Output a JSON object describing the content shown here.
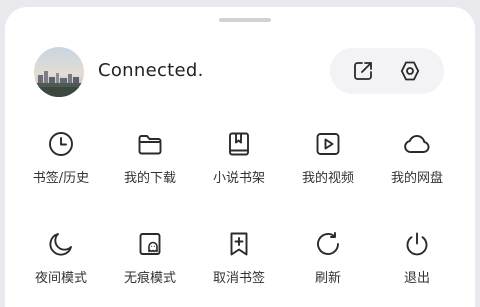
{
  "profile": {
    "status_text": "Connected."
  },
  "header_actions": {
    "share_icon": "share-out-icon",
    "settings_icon": "hexagon-settings-icon"
  },
  "menu": {
    "row1": [
      {
        "label": "书签/历史",
        "icon": "clock-icon"
      },
      {
        "label": "我的下载",
        "icon": "folder-icon"
      },
      {
        "label": "小说书架",
        "icon": "book-icon"
      },
      {
        "label": "我的视频",
        "icon": "play-icon"
      },
      {
        "label": "我的网盘",
        "icon": "cloud-icon"
      }
    ],
    "row2": [
      {
        "label": "夜间模式",
        "icon": "moon-icon"
      },
      {
        "label": "无痕模式",
        "icon": "ghost-icon"
      },
      {
        "label": "取消书签",
        "icon": "bookmark-plus-icon"
      },
      {
        "label": "刷新",
        "icon": "refresh-icon"
      },
      {
        "label": "退出",
        "icon": "power-icon"
      }
    ]
  },
  "colors": {
    "background": "#e9e9ee",
    "sheet": "#ffffff",
    "icon_stroke": "#2a2a2a",
    "pill": "#f3f3f5"
  }
}
